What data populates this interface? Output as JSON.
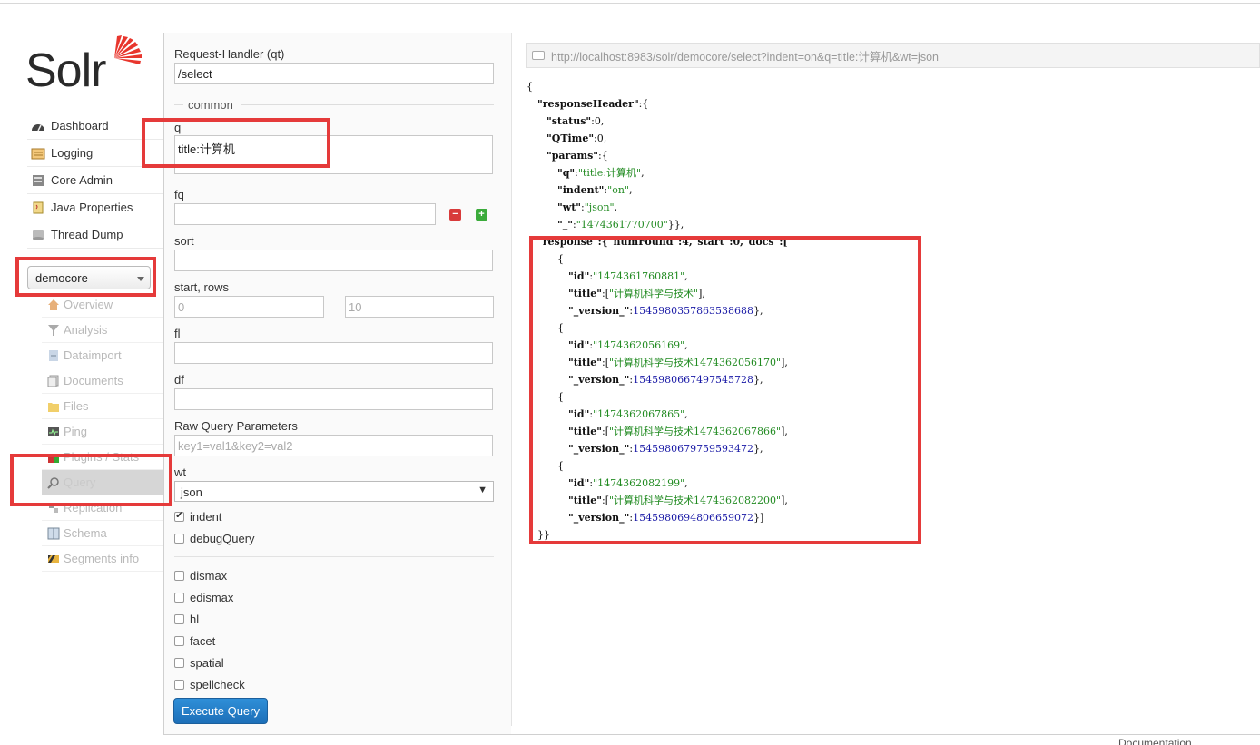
{
  "brand": {
    "name": "Solr"
  },
  "nav": [
    {
      "label": "Dashboard",
      "icon": "dashboard-icon"
    },
    {
      "label": "Logging",
      "icon": "logging-icon"
    },
    {
      "label": "Core Admin",
      "icon": "core-admin-icon"
    },
    {
      "label": "Java Properties",
      "icon": "java-icon"
    },
    {
      "label": "Thread Dump",
      "icon": "thread-dump-icon"
    }
  ],
  "core_selector": {
    "value": "democore"
  },
  "core_nav": [
    {
      "label": "Overview",
      "icon": "home-icon"
    },
    {
      "label": "Analysis",
      "icon": "filter-icon"
    },
    {
      "label": "Dataimport",
      "icon": "dataimport-icon"
    },
    {
      "label": "Documents",
      "icon": "documents-icon"
    },
    {
      "label": "Files",
      "icon": "files-icon"
    },
    {
      "label": "Ping",
      "icon": "ping-icon"
    },
    {
      "label": "Plugins / Stats",
      "icon": "plugins-icon"
    },
    {
      "label": "Query",
      "icon": "query-icon",
      "active": true
    },
    {
      "label": "Replication",
      "icon": "replication-icon"
    },
    {
      "label": "Schema",
      "icon": "schema-icon"
    },
    {
      "label": "Segments info",
      "icon": "segments-icon"
    }
  ],
  "form": {
    "qt_label": "Request-Handler (qt)",
    "qt_value": "/select",
    "common_label": "common",
    "q_label": "q",
    "q_value": "title:计算机",
    "fq_label": "fq",
    "sort_label": "sort",
    "start_rows_label": "start, rows",
    "start_placeholder": "0",
    "rows_placeholder": "10",
    "fl_label": "fl",
    "df_label": "df",
    "raw_label": "Raw Query Parameters",
    "raw_placeholder": "key1=val1&key2=val2",
    "wt_label": "wt",
    "wt_value": "json",
    "indent_label": "indent",
    "debug_label": "debugQuery",
    "dismax_label": "dismax",
    "edismax_label": "edismax",
    "hl_label": "hl",
    "facet_label": "facet",
    "spatial_label": "spatial",
    "spellcheck_label": "spellcheck",
    "execute_label": "Execute Query"
  },
  "url": "http://localhost:8983/solr/democore/select?indent=on&q=title:计算机&wt=json",
  "response": {
    "open_brace": "{",
    "rh_key": "\"responseHeader\"",
    "rh_open": ":{",
    "status_key": "\"status\"",
    "status_val": "0",
    "qtime_key": "\"QTime\"",
    "qtime_val": "0",
    "params_key": "\"params\"",
    "params_open": ":{",
    "q_key": "\"q\"",
    "q_val": "\"title:计算机\"",
    "indent_key": "\"indent\"",
    "indent_val": "\"on\"",
    "wt_key": "\"wt\"",
    "wt_val": "\"json\"",
    "ts_key": "\"_\"",
    "ts_val": "\"1474361770700\"",
    "ts_close": "}},",
    "response_line": "\"response\":{\"numFound\":4,\"start\":0,\"docs\":[",
    "docs": [
      {
        "id": "\"1474361760881\"",
        "title": "\"计算机科学与技术\"",
        "version": "1545980357863538688",
        "close": "},"
      },
      {
        "id": "\"1474362056169\"",
        "title": "\"计算机科学与技术1474362056170\"",
        "version": "1545980667497545728",
        "close": "},"
      },
      {
        "id": "\"1474362067865\"",
        "title": "\"计算机科学与技术1474362067866\"",
        "version": "1545980679759593472",
        "close": "},"
      },
      {
        "id": "\"1474362082199\"",
        "title": "\"计算机科学与技术1474362082200\"",
        "version": "1545980694806659072",
        "close": "}]"
      }
    ],
    "doc_open": "{",
    "id_key": "\"id\"",
    "title_key": "\"title\"",
    "version_key": "\"_version_\"",
    "end": "}}"
  },
  "footer": {
    "text": "Documentation"
  },
  "colors": {
    "highlight": "#e53a3a",
    "execute_button": "#1d6fb8",
    "json_string": "#228b22",
    "json_number": "#1a1aa6"
  }
}
